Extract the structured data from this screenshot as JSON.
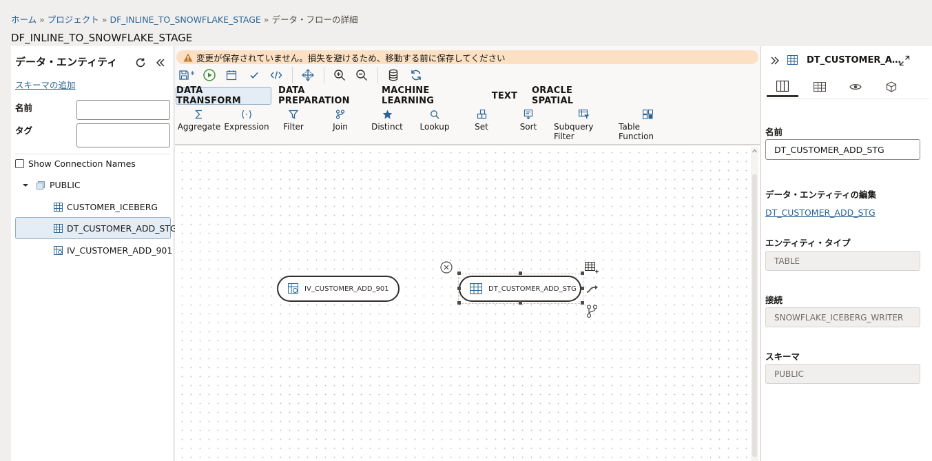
{
  "breadcrumb": {
    "home": "ホーム",
    "projects": "プロジェクト",
    "flow": "DF_INLINE_TO_SNOWFLAKE_STAGE",
    "current": "データ・フローの詳細",
    "separator": "»"
  },
  "page_title": "DF_INLINE_TO_SNOWFLAKE_STAGE",
  "left_panel": {
    "title": "データ・エンティティ",
    "add_schema_link": "スキーマの追加",
    "name_label": "名前",
    "tag_label": "タグ",
    "name_value": "",
    "tag_value": "",
    "show_connection_names": "Show Connection Names",
    "tree": {
      "schema": "PUBLIC",
      "items": [
        {
          "label": "CUSTOMER_ICEBERG",
          "icon": "table-icon"
        },
        {
          "label": "DT_CUSTOMER_ADD_STG",
          "icon": "table-icon"
        },
        {
          "label": "IV_CUSTOMER_ADD_901",
          "icon": "view-icon"
        }
      ]
    }
  },
  "warning": "変更が保存されていません。損失を避けるため、移動する前に保存してください",
  "save_dirty_marker": "*",
  "tabs": [
    "DATA TRANSFORM",
    "DATA PREPARATION",
    "MACHINE LEARNING",
    "TEXT",
    "ORACLE SPATIAL"
  ],
  "operators": [
    "Aggregate",
    "Expression",
    "Filter",
    "Join",
    "Distinct",
    "Lookup",
    "Set",
    "Sort",
    "Subquery Filter",
    "Table Function"
  ],
  "canvas": {
    "nodes": [
      {
        "label": "IV_CUSTOMER_ADD_901"
      },
      {
        "label": "DT_CUSTOMER_ADD_STG"
      }
    ]
  },
  "right_panel": {
    "title": "DT_CUSTOMER_A…",
    "name_label": "名前",
    "name_value": "DT_CUSTOMER_ADD_STG",
    "edit_entity_label": "データ・エンティティの編集",
    "edit_entity_link": "DT_CUSTOMER_ADD_STG",
    "entity_type_label": "エンティティ・タイプ",
    "entity_type_value": "TABLE",
    "connection_label": "接続",
    "connection_value": "SNOWFLAKE_ICEBERG_WRITER",
    "schema_label": "スキーマ",
    "schema_value": "PUBLIC"
  },
  "colors": {
    "link": "#2a6496",
    "warning_bg": "#fbe0c3",
    "warning_icon": "#c0782d",
    "run_green": "#3c8d3c",
    "icon_blue": "#2a6496"
  }
}
